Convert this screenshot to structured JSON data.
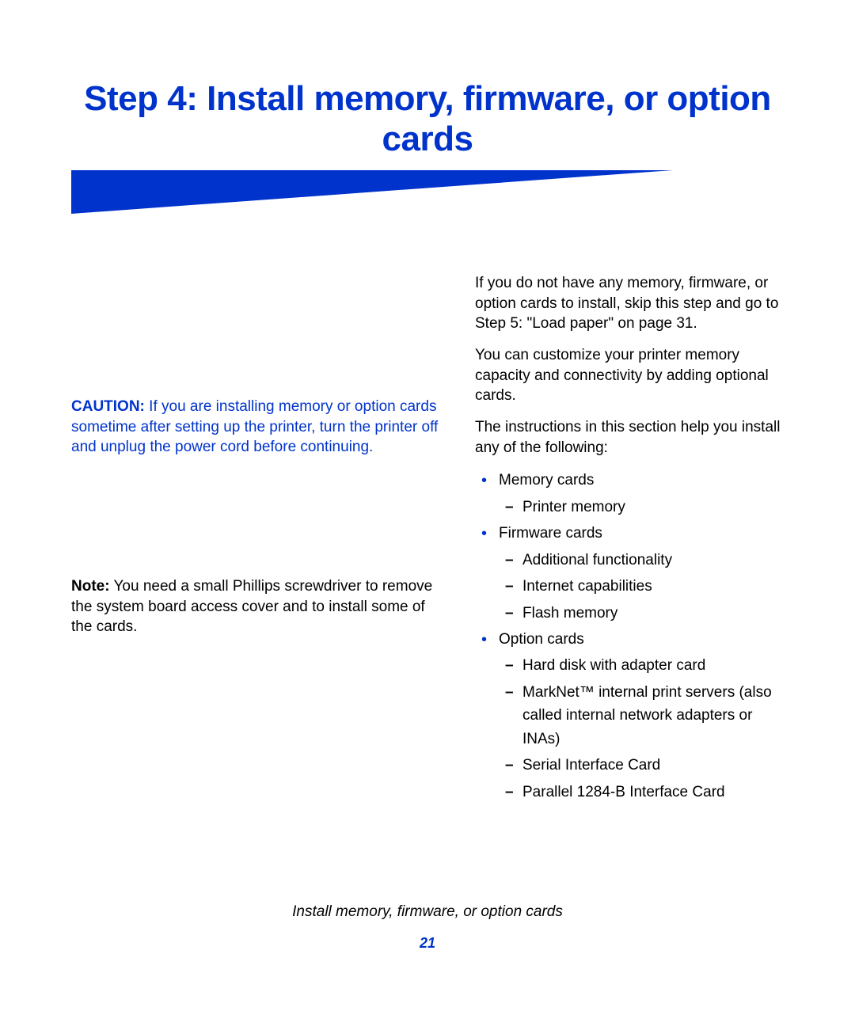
{
  "title": "Step 4: Install memory, firmware, or option cards",
  "caution": {
    "label": "CAUTION:",
    "text": " If you are installing memory or option cards sometime after setting up the printer, turn the printer off and unplug the power cord before continuing."
  },
  "note": {
    "label": "Note:",
    "text": " You need a small Phillips screwdriver to remove the system board access cover and to install some of the cards."
  },
  "right": {
    "p1": "If you do not have any memory, firmware, or option cards to install, skip this step and go to Step 5: \"Load paper\" on page 31.",
    "p2": "You can customize your printer memory capacity and connectivity by adding optional cards.",
    "p3": "The instructions in this section help you install any of the following:",
    "list": {
      "i1": {
        "label": "Memory cards",
        "sub": {
          "s1": "Printer memory"
        }
      },
      "i2": {
        "label": "Firmware cards",
        "sub": {
          "s1": "Additional functionality",
          "s2": "Internet capabilities",
          "s3": "Flash memory"
        }
      },
      "i3": {
        "label": "Option cards",
        "sub": {
          "s1": "Hard disk with adapter card",
          "s2": "MarkNet™ internal print servers (also called internal network adapters or INAs)",
          "s3": "Serial Interface Card",
          "s4": "Parallel 1284-B Interface Card"
        }
      }
    }
  },
  "footer": {
    "title": "Install memory, firmware, or option cards",
    "page": "21"
  }
}
